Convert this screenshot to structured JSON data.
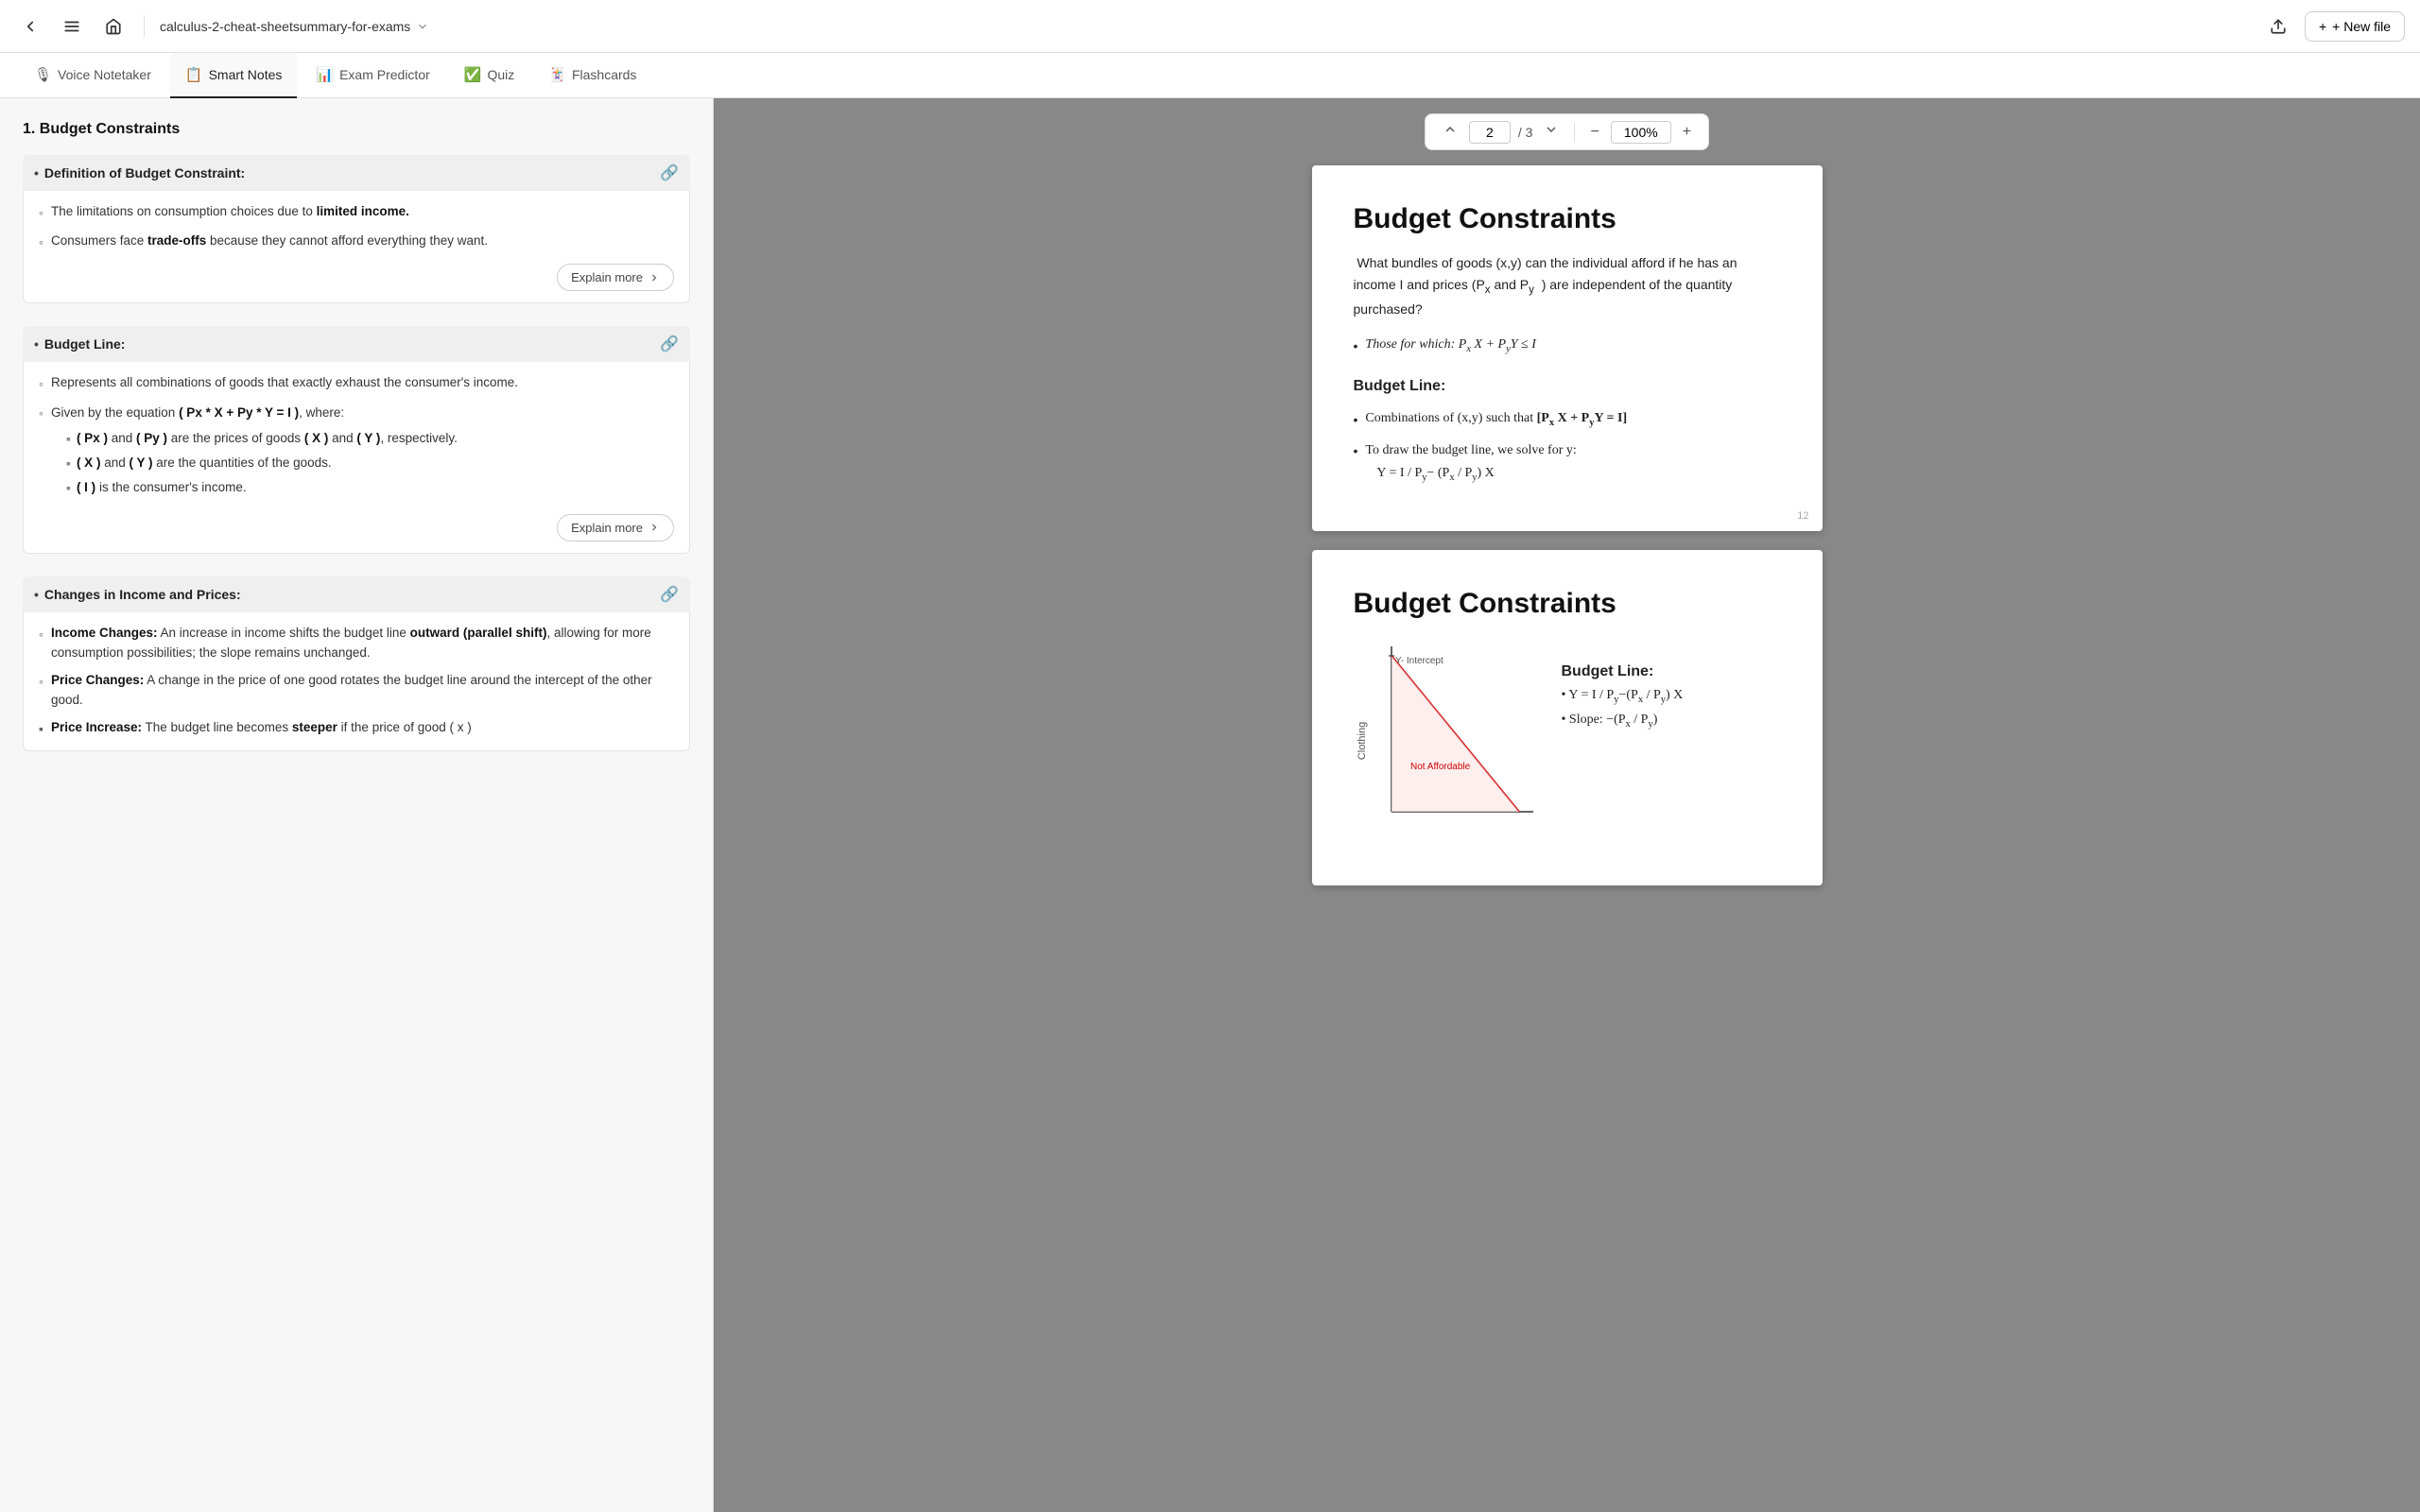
{
  "topbar": {
    "back_icon": "←",
    "menu_icon": "☰",
    "home_icon": "⌂",
    "filename": "calculus-2-cheat-sheetsummary-for-exams",
    "chevron_icon": "∨",
    "upload_icon": "↑",
    "new_file_label": "+ New file"
  },
  "tabs": [
    {
      "id": "voice",
      "label": "Voice Notetaker",
      "icon": "🎙",
      "active": false
    },
    {
      "id": "smart",
      "label": "Smart Notes",
      "icon": "📋",
      "active": true
    },
    {
      "id": "exam",
      "label": "Exam Predictor",
      "icon": "📊",
      "active": false
    },
    {
      "id": "quiz",
      "label": "Quiz",
      "icon": "✅",
      "active": false
    },
    {
      "id": "flash",
      "label": "Flashcards",
      "icon": "🃏",
      "active": false
    }
  ],
  "notes": {
    "section_title": "1. Budget Constraints",
    "subsections": [
      {
        "id": "def",
        "title": "Definition of Budget Constraint:",
        "items": [
          {
            "text": "The limitations on consumption choices due to <b>limited income.</b>"
          },
          {
            "text": "Consumers face <b>trade-offs</b> because they cannot afford everything they want."
          }
        ],
        "explain_label": "Explain more",
        "has_explain": true
      },
      {
        "id": "budget-line",
        "title": "Budget Line:",
        "items": [
          {
            "text": "Represents all combinations of goods that exactly exhaust the consumer's income."
          },
          {
            "text": "Given by the equation <b>( Px * X + Py * Y = I )</b>, where:",
            "subitems": [
              {
                "text": "<b>( Px )</b> and <b>( Py )</b> are the prices of goods <b>( X )</b> and <b>( Y )</b>, respectively."
              },
              {
                "text": "<b>( X )</b> and <b>( Y )</b> are the quantities of the goods."
              },
              {
                "text": "<b>( I )</b> is the consumer's income."
              }
            ]
          }
        ],
        "explain_label": "Explain more",
        "has_explain": true
      },
      {
        "id": "changes",
        "title": "Changes in Income and Prices:",
        "items": [
          {
            "text": "<b>Income Changes:</b> An increase in income shifts the budget line <b>outward (parallel shift)</b>, allowing for more consumption possibilities; the slope remains unchanged."
          },
          {
            "text": "<b>Price Changes:</b> A change in the price of one good rotates the budget line around the intercept of the other good."
          },
          {
            "text": "<b>Price Increase:</b> The budget line becomes <b>steeper</b> if the price of good ( x )"
          }
        ],
        "has_explain": false
      }
    ]
  },
  "pdf": {
    "page_current": "2",
    "page_total": "3",
    "zoom": "100%",
    "pages": [
      {
        "page_num": "12",
        "heading": "Budget Constraints",
        "intro": "What bundles of goods (x,y) can the individual afford if he has an income I and prices (P",
        "intro_sub_x": "x",
        "intro_and": " and P",
        "intro_sub_y": "y",
        "intro_end": "  ) are independent of the quantity purchased?",
        "bullet1": "Those for which:  P",
        "b1_sub": "x",
        "b1_mid": " X + P",
        "b1_sub2": "y",
        "b1_end": "Y  ≤ I",
        "section": "Budget Line:",
        "bl1": "Combinations of (x,y) such that ",
        "bl1_bold": "[P",
        "bl1_bold_sub": "x",
        "bl1_bold_mid": " X + P",
        "bl1_bold_sub2": "y",
        "bl1_bold_end": "Y = I]",
        "bl2": "To draw the budget line, we solve for y:",
        "bl2_eq": "Y = I / P",
        "bl2_eq_sub": "y",
        "bl2_eq_mid": "− (P",
        "bl2_eq_sub2": "x",
        "bl2_eq_mid2": " / P",
        "bl2_eq_sub3": "y",
        "bl2_eq_end": ") X"
      },
      {
        "page_num": "",
        "heading": "Budget Constraints",
        "section": "Budget Line:",
        "formula1": "• Y = I / P",
        "f1_sub": "y",
        "f1_mid": "−(P",
        "f1_sub2": "x",
        "f1_mid2": " / P",
        "f1_sub3": "y",
        "f1_end": ") X",
        "formula2": "• Slope: −(P",
        "f2_sub": "x",
        "f2_mid": " / P",
        "f2_sub2": "y",
        "f2_end": ")",
        "chart": {
          "y_label": "Clothing",
          "y_intercept": "Y- Intercept",
          "not_affordable": "Not Affordable",
          "shaded_color": "#fde8e8"
        }
      }
    ]
  }
}
